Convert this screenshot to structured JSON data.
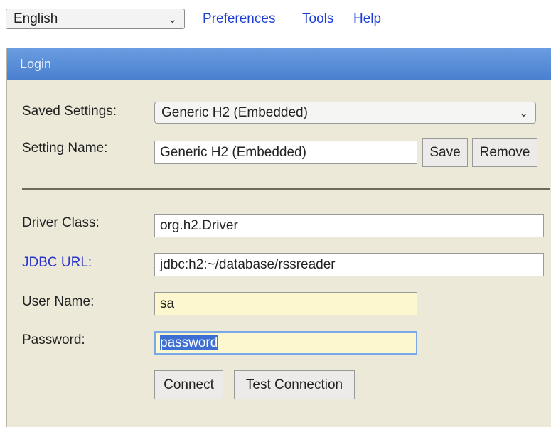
{
  "topbar": {
    "language": "English",
    "links": [
      "Preferences",
      "Tools",
      "Help"
    ]
  },
  "panel": {
    "title": "Login",
    "saved_settings_label": "Saved Settings:",
    "saved_settings_value": "Generic H2 (Embedded)",
    "setting_name_label": "Setting Name:",
    "setting_name_value": "Generic H2 (Embedded)",
    "save_button": "Save",
    "remove_button": "Remove",
    "driver_class_label": "Driver Class:",
    "driver_class_value": "org.h2.Driver",
    "jdbc_url_label": "JDBC URL:",
    "jdbc_url_value": "jdbc:h2:~/database/rssreader",
    "user_name_label": "User Name:",
    "user_name_value": "sa",
    "password_label": "Password:",
    "password_value": "password",
    "connect_button": "Connect",
    "test_connection_button": "Test Connection"
  },
  "colors": {
    "header_blue": "#5a8ed8",
    "panel_bg": "#ece9d9",
    "link_blue": "#1e3fd8",
    "autofill_yellow": "#fdf7cf",
    "selection_blue": "#3d6fd3"
  }
}
